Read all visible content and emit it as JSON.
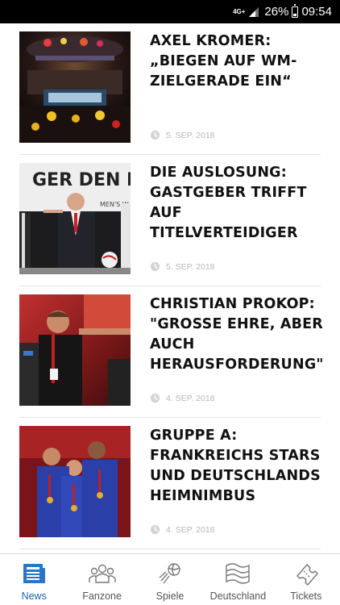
{
  "status_bar": {
    "network": "4G+",
    "battery": "26%",
    "time": "09:54"
  },
  "articles": [
    {
      "headline": "AXEL KROMER: „BIEGEN AUF WM-ZIELGERADE EIN“",
      "date": "5. SEP. 2018"
    },
    {
      "headline": "DIE AUSLOSUNG: GASTGEBER TRIFFT AUF TITELVERTEIDIGER",
      "date": "5. SEP. 2018",
      "image_text": "GER DEN HAND",
      "image_text2": "MEN'S W"
    },
    {
      "headline": "CHRISTIAN PROKOP: \"GROSSE EHRE, ABER AUCH HERAUSFORDERUNG\"",
      "date": "4. SEP. 2018"
    },
    {
      "headline": "GRUPPE A: FRANKREICHS STARS UND DEUTSCHLANDS HEIMNIMBUS",
      "date": "4. SEP. 2018"
    }
  ],
  "bottom_nav": {
    "items": [
      {
        "label": "News",
        "icon": "newspaper-icon",
        "active": true
      },
      {
        "label": "Fanzone",
        "icon": "group-icon",
        "active": false
      },
      {
        "label": "Spiele",
        "icon": "handball-icon",
        "active": false
      },
      {
        "label": "Deutschland",
        "icon": "flag-icon",
        "active": false
      },
      {
        "label": "Tickets",
        "icon": "ticket-icon",
        "active": false
      }
    ]
  },
  "colors": {
    "accent": "#1b63b1",
    "meta_gray": "#b8b8b8",
    "headline": "#111111"
  }
}
